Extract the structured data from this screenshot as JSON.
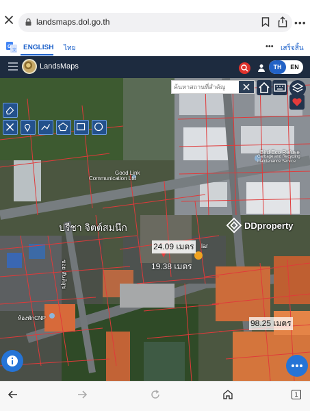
{
  "browser": {
    "url": "landsmaps.dol.go.th",
    "icons": [
      "close-icon",
      "lock-icon",
      "bookmark-icon",
      "share-icon",
      "more-icon"
    ],
    "more_label": "•••"
  },
  "translate_bar": {
    "english_label": "ENGLISH",
    "thai_label": "ไทย",
    "more_label": "•••",
    "done_label": "เสร็จสิ้น",
    "active_color": "#1a5fc9"
  },
  "app": {
    "title": "LandsMaps",
    "lang_th": "TH",
    "lang_en": "EN",
    "header_color": "#1d2b3f",
    "accent_color": "#2262c6",
    "search_color": "#e0322c"
  },
  "map": {
    "search_placeholder": "ค้นหาสถานที่สำคัญ",
    "labels": {
      "comm_line1": "Good Link",
      "comm_line2": "Communication Ltd",
      "bird_line1": "Bird Eco Refuse",
      "bird_line2": "Garbage and Recycling",
      "bird_line3": "Maintenance Service",
      "owner_name": "ปรีชา จิตต์สมนึก",
      "road_name": "ซอย สันติสุข",
      "dorm": "ห้องพักCNP",
      "watermark": "DDproperty"
    },
    "measurements": {
      "m1": "24.09 เมตร",
      "m2": "19.38 เมตร",
      "m3": "98.25 เมตร",
      "m1_tail": "lar"
    },
    "tools": [
      "eraser-icon",
      "tools-icon",
      "pin-icon",
      "polyline-icon",
      "polygon-icon",
      "rectangle-icon",
      "circle-icon"
    ],
    "right_controls": [
      "home-icon",
      "keyboard-icon",
      "layers-icon",
      "heart-icon"
    ],
    "marker_color": "#e33b3b"
  },
  "fabs": {
    "info": "info-icon",
    "more": "more-icon",
    "color": "#2574d6"
  },
  "bottom_nav": [
    "back-icon",
    "forward-icon",
    "reload-icon",
    "home-icon",
    "tabs-icon"
  ],
  "bottom_nav_tabs_count": "1"
}
